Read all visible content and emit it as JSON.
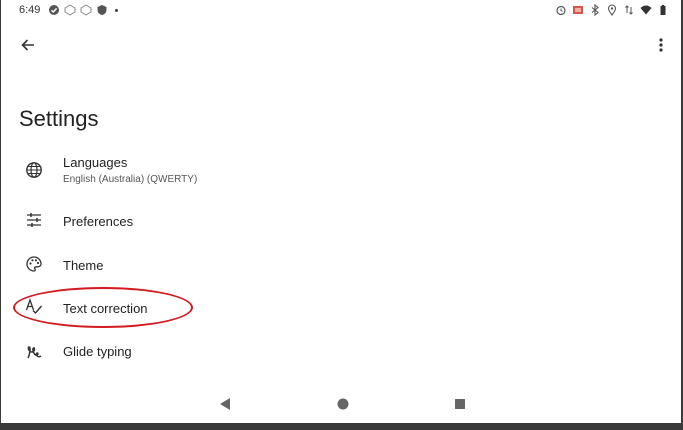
{
  "status_bar": {
    "time": "6:49",
    "left_icons": [
      "check-circle-icon",
      "notification-icon",
      "notification-icon",
      "shield-icon"
    ],
    "right_icons": [
      "alarm-icon",
      "battery-saver-icon",
      "bluetooth-icon",
      "location-icon",
      "data-arrows-icon",
      "wifi-icon",
      "battery-icon"
    ]
  },
  "header": {
    "back_icon": "arrow-left-icon",
    "menu_icon": "more-vertical-icon"
  },
  "page": {
    "title": "Settings"
  },
  "items": [
    {
      "label": "Languages",
      "subtitle": "English (Australia) (QWERTY)",
      "icon": "globe-icon"
    },
    {
      "label": "Preferences",
      "icon": "sliders-icon"
    },
    {
      "label": "Theme",
      "icon": "palette-icon"
    },
    {
      "label": "Text correction",
      "icon": "text-correction-icon"
    },
    {
      "label": "Glide typing",
      "icon": "glide-icon"
    }
  ],
  "navigation": {
    "buttons": [
      "back-triangle-icon",
      "home-circle-icon",
      "recents-square-icon"
    ]
  },
  "colors": {
    "background": "#ffffff",
    "text": "#222222",
    "annotation": "#d41a1f"
  }
}
